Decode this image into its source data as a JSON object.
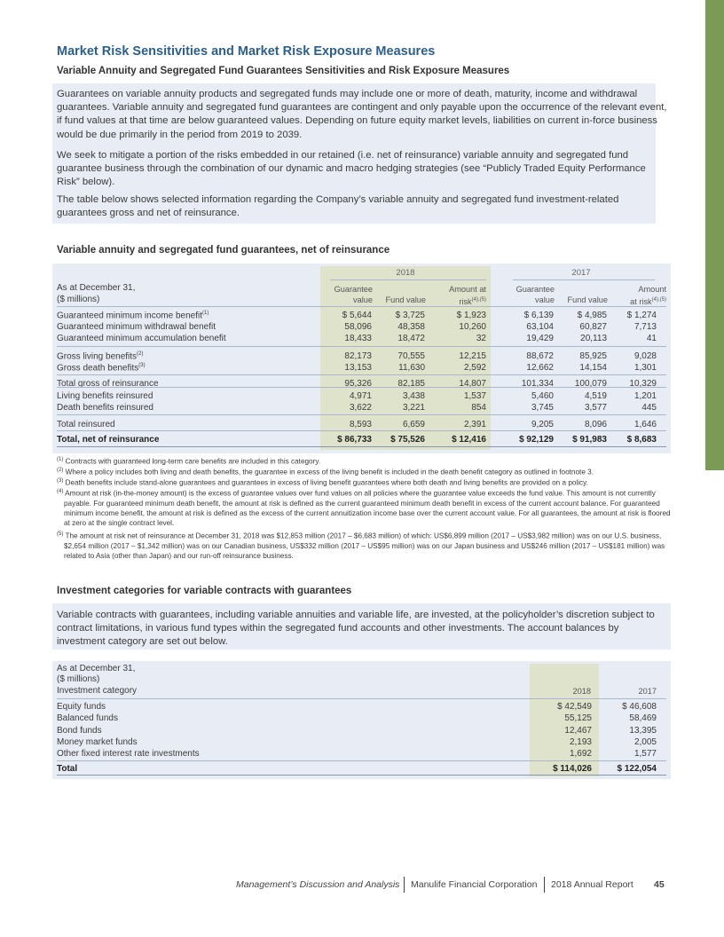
{
  "heading": "Market Risk Sensitivities and Market Risk Exposure Measures",
  "subheading": "Variable Annuity and Segregated Fund Guarantees Sensitivities and Risk Exposure Measures",
  "intro": [
    "Guarantees on variable annuity products and segregated funds may include one or more of death, maturity, income and withdrawal guarantees. Variable annuity and segregated fund guarantees are contingent and only payable upon the occurrence of the relevant event, if fund values at that time are below guaranteed values. Depending on future equity market levels, liabilities on current in-force business would be due primarily in the period from 2019 to 2039.",
    "We seek to mitigate a portion of the risks embedded in our retained (i.e. net of reinsurance) variable annuity and segregated fund guarantee business through the combination of our dynamic and macro hedging strategies (see “Publicly Traded Equity Performance Risk” below).",
    "The table below shows selected information regarding the Company’s variable annuity and segregated fund investment-related guarantees gross and net of reinsurance."
  ],
  "table1": {
    "title": "Variable annuity and segregated fund guarantees, net of reinsurance",
    "year_2018": "2018",
    "year_2017": "2017",
    "label_line1": "As at December 31,",
    "label_line2": "($ millions)",
    "col_headers": {
      "gv1": "Guarantee",
      "gv2": "value",
      "fv1": "Fund value",
      "ar1": "Amount at",
      "ar2": "risk",
      "ar_sup": "(4),(5)",
      "ar2017_1": "Amount",
      "ar2017_2": "at risk",
      "ar2017_sup": "(4),(5)"
    },
    "rows": [
      {
        "label": "Guaranteed minimum income benefit",
        "sup": "(1)",
        "v": [
          "$ 5,644",
          "$ 3,725",
          "$ 1,923",
          "$ 6,139",
          "$ 4,985",
          "$ 1,274"
        ]
      },
      {
        "label": "Guaranteed minimum withdrawal benefit",
        "sup": "",
        "v": [
          "58,096",
          "48,358",
          "10,260",
          "63,104",
          "60,827",
          "7,713"
        ]
      },
      {
        "label": "Guaranteed minimum accumulation benefit",
        "sup": "",
        "v": [
          "18,433",
          "18,472",
          "32",
          "19,429",
          "20,113",
          "41"
        ]
      },
      {
        "label": "Gross living benefits",
        "sup": "(2)",
        "v": [
          "82,173",
          "70,555",
          "12,215",
          "88,672",
          "85,925",
          "9,028"
        ]
      },
      {
        "label": "Gross death benefits",
        "sup": "(3)",
        "v": [
          "13,153",
          "11,630",
          "2,592",
          "12,662",
          "14,154",
          "1,301"
        ]
      },
      {
        "label": "Total gross of reinsurance",
        "sup": "",
        "v": [
          "95,326",
          "82,185",
          "14,807",
          "101,334",
          "100,079",
          "10,329"
        ]
      },
      {
        "label": "Living benefits reinsured",
        "sup": "",
        "v": [
          "4,971",
          "3,438",
          "1,537",
          "5,460",
          "4,519",
          "1,201"
        ]
      },
      {
        "label": "Death benefits reinsured",
        "sup": "",
        "v": [
          "3,622",
          "3,221",
          "854",
          "3,745",
          "3,577",
          "445"
        ]
      },
      {
        "label": "Total reinsured",
        "sup": "",
        "v": [
          "8,593",
          "6,659",
          "2,391",
          "9,205",
          "8,096",
          "1,646"
        ]
      },
      {
        "label": "Total, net of reinsurance",
        "sup": "",
        "v": [
          "$ 86,733",
          "$ 75,526",
          "$ 12,416",
          "$ 92,129",
          "$ 91,983",
          "$ 8,683"
        ]
      }
    ],
    "footnotes": [
      {
        "n": "(1)",
        "t": "Contracts with guaranteed long-term care benefits are included in this category."
      },
      {
        "n": "(2)",
        "t": "Where a policy includes both living and death benefits, the guarantee in excess of the living benefit is included in the death benefit category as outlined in footnote 3."
      },
      {
        "n": "(3)",
        "t": "Death benefits include stand-alone guarantees and guarantees in excess of living benefit guarantees where both death and living benefits are provided on a policy."
      },
      {
        "n": "(4)",
        "t": "Amount at risk (in-the-money amount) is the excess of guarantee values over fund values on all policies where the guarantee value exceeds the fund value. This amount is not currently payable. For guaranteed minimum death benefit, the amount at risk is defined as the current guaranteed minimum death benefit in excess of the current account balance. For guaranteed minimum income benefit, the amount at risk is defined as the excess of the current annuitization income base over the current account value. For all guarantees, the amount at risk is floored at zero at the single contract level."
      },
      {
        "n": "(5)",
        "t": "The amount at risk net of reinsurance at December 31, 2018 was $12,853 million (2017 – $6,683 million) of which: US$6,899 million (2017 – US$3,982 million) was on our U.S. business, $2,654 million (2017 – $1,342 million) was on our Canadian business, US$332 million (2017 – US$95 million) was on our Japan business and US$246 million (2017 – US$181 million) was related to Asia (other than Japan) and our run-off reinsurance business."
      }
    ]
  },
  "section2": {
    "title": "Investment categories for variable contracts with guarantees",
    "para": "Variable contracts with guarantees, including variable annuities and variable life, are invested, at the policyholder’s discretion subject to contract limitations, in various fund types within the segregated fund accounts and other investments. The account balances by investment category are set out below."
  },
  "table2": {
    "label_line1": "As at December 31,",
    "label_line2": "($ millions)",
    "cat_label": "Investment category",
    "col_2018": "2018",
    "col_2017": "2017",
    "rows": [
      {
        "label": "Equity funds",
        "v": [
          "$ 42,549",
          "$ 46,608"
        ]
      },
      {
        "label": "Balanced funds",
        "v": [
          "55,125",
          "58,469"
        ]
      },
      {
        "label": "Bond funds",
        "v": [
          "12,467",
          "13,395"
        ]
      },
      {
        "label": "Money market funds",
        "v": [
          "2,193",
          "2,005"
        ]
      },
      {
        "label": "Other fixed interest rate investments",
        "v": [
          "1,692",
          "1,577"
        ]
      },
      {
        "label": "Total",
        "v": [
          "$ 114,026",
          "$ 122,054"
        ]
      }
    ]
  },
  "footer": {
    "section": "Management’s Discussion and Analysis",
    "company": "Manulife Financial Corporation",
    "report": "2018 Annual Report",
    "page": "45"
  }
}
